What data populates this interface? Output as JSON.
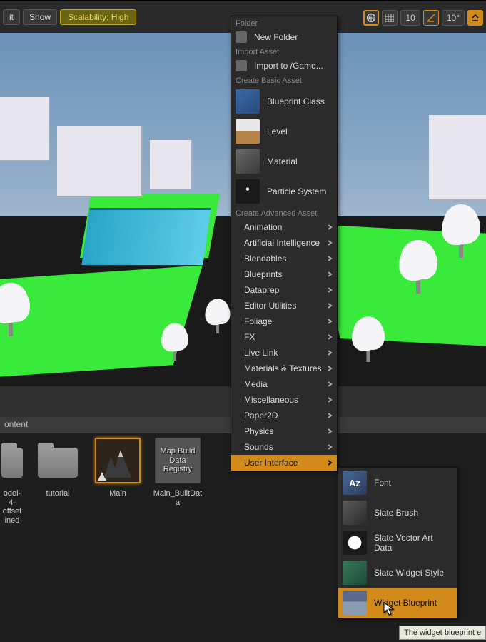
{
  "toolbar": {
    "lit_label": "it",
    "show_label": "Show",
    "scalability_label": "Scalability: High",
    "snap_grid_value": "10",
    "snap_angle_value": "10°"
  },
  "content_browser": {
    "header_label": "ontent",
    "items": [
      {
        "label": "odel-\n4-offset\nined"
      },
      {
        "label": "tutorial"
      },
      {
        "label": "Main"
      },
      {
        "label": "Main_BuiltData"
      }
    ],
    "map_build_overlay": "Map Build\nData\nRegistry"
  },
  "context_menu": {
    "sections": {
      "folder": "Folder",
      "import": "Import Asset",
      "basic": "Create Basic Asset",
      "advanced": "Create Advanced Asset"
    },
    "new_folder": "New Folder",
    "import_to": "Import to /Game...",
    "basic_assets": [
      "Blueprint Class",
      "Level",
      "Material",
      "Particle System"
    ],
    "advanced_categories": [
      "Animation",
      "Artificial Intelligence",
      "Blendables",
      "Blueprints",
      "Dataprep",
      "Editor Utilities",
      "Foliage",
      "FX",
      "Live Link",
      "Materials & Textures",
      "Media",
      "Miscellaneous",
      "Paper2D",
      "Physics",
      "Sounds",
      "User Interface"
    ]
  },
  "submenu": {
    "items": [
      "Font",
      "Slate Brush",
      "Slate Vector Art Data",
      "Slate Widget Style",
      "Widget Blueprint"
    ]
  },
  "tooltip_text": "The widget blueprint e"
}
